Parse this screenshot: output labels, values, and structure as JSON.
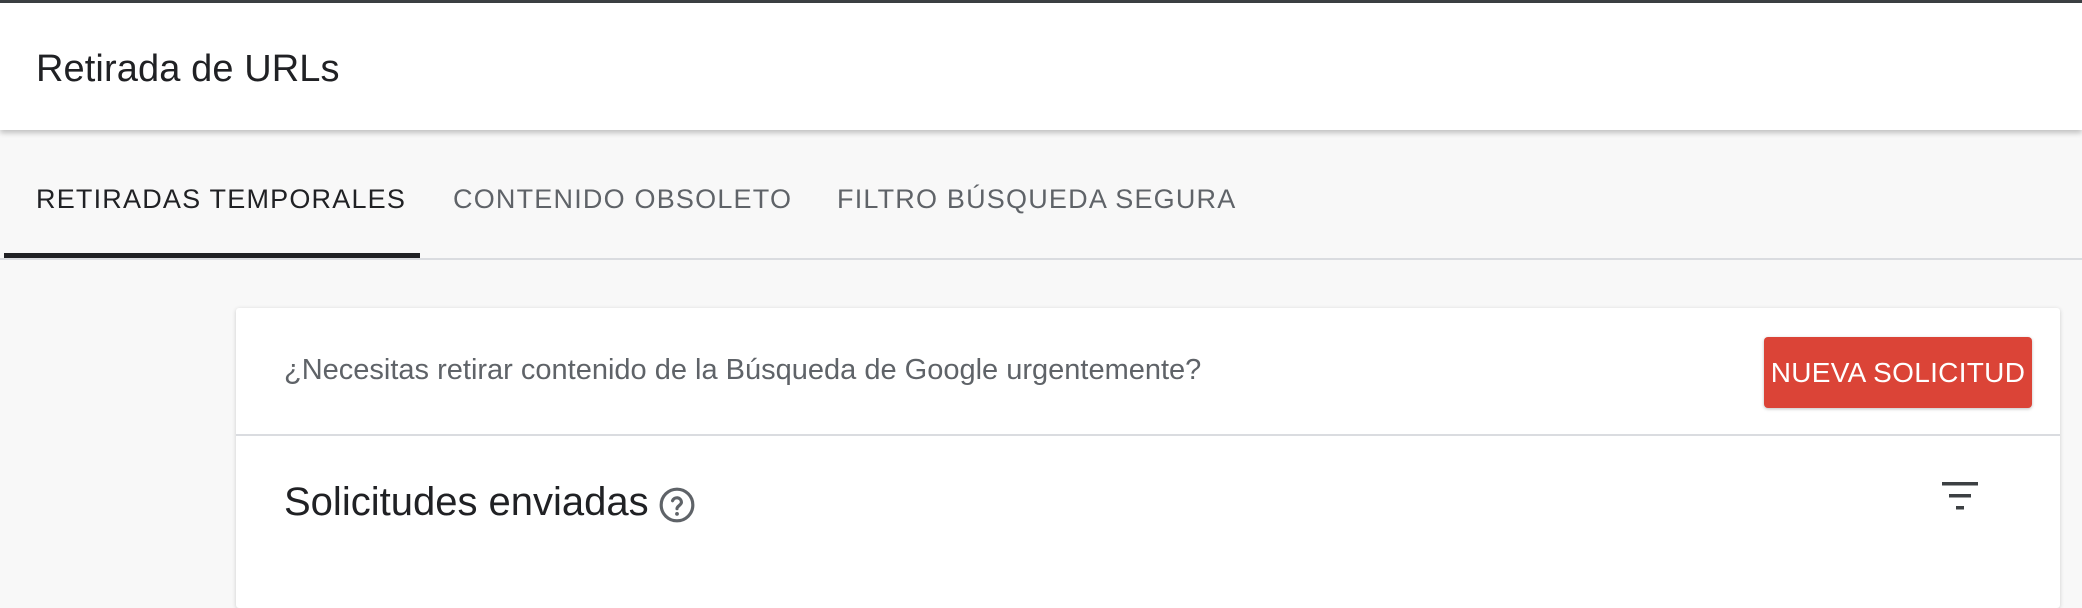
{
  "header": {
    "title": "Retirada de URLs"
  },
  "tabs": [
    {
      "label": "RETIRADAS TEMPORALES",
      "active": true
    },
    {
      "label": "CONTENIDO OBSOLETO",
      "active": false
    },
    {
      "label": "FILTRO BÚSQUEDA SEGURA",
      "active": false
    }
  ],
  "banner": {
    "question": "¿Necesitas retirar contenido de la Búsqueda de Google urgentemente?",
    "button_label": "NUEVA SOLICITUD"
  },
  "requests": {
    "title": "Solicitudes enviadas",
    "help_icon": "help-circle-icon",
    "filter_icon": "filter-list-icon"
  },
  "colors": {
    "accent_red": "#db4437",
    "text_primary": "#202124",
    "text_secondary": "#5f6368",
    "background": "#f8f8f8"
  }
}
